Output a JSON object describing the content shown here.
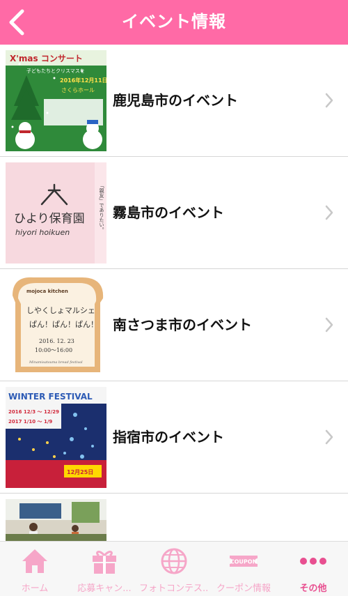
{
  "header": {
    "title": "イベント情報",
    "back_icon": "chevron-left-icon"
  },
  "events": [
    {
      "label": "鹿児島市のイベント",
      "thumb": "xmas-concert-poster",
      "thumb_text": {
        "title": "X'mas コンサート",
        "sub": "子どもたちとクリスマスを",
        "date": "2016年12月11日",
        "venue": "さくらホール"
      }
    },
    {
      "label": "霧島市のイベント",
      "thumb": "hiyori-hoikuen-logo",
      "thumb_text": {
        "logo_jp": "ひより保育園",
        "logo_en": "hiyori hoikuen",
        "side": "「親友」でありたい。"
      }
    },
    {
      "label": "南さつま市のイベント",
      "thumb": "bread-marche-poster",
      "thumb_text": {
        "brand": "mojoca kitchen",
        "line1": "しやくしょマルシェ",
        "line2": "ぱん！ぱん！ぱん！",
        "date": "2016. 12. 23",
        "time": "10:00～16:00",
        "footer": "Minamisatsuma bread festival"
      }
    },
    {
      "label": "指宿市のイベント",
      "thumb": "winter-festival-poster",
      "thumb_text": {
        "title": "WINTER FESTIVAL",
        "d1": "2016 12/3 ～ 12/29",
        "d2": "2017 1/10 ～ 1/9",
        "badge": "12月25日"
      }
    },
    {
      "label": "",
      "thumb": "classroom-photo",
      "thumb_text": {}
    }
  ],
  "tabs": [
    {
      "label": "ホーム",
      "icon": "home-icon",
      "active": false
    },
    {
      "label": "応募キャン...",
      "icon": "gift-icon",
      "active": false
    },
    {
      "label": "フォトコンテス...",
      "icon": "globe-icon",
      "active": false
    },
    {
      "label": "クーポン情報",
      "icon": "coupon-icon",
      "icon_text": "COUPON",
      "active": false
    },
    {
      "label": "その他",
      "icon": "more-icon",
      "active": true
    }
  ],
  "colors": {
    "header": "#ff6aa6",
    "tab_icon": "#f6a6c8",
    "tab_active": "#e84f90",
    "chevron": "#c8c8c8"
  }
}
